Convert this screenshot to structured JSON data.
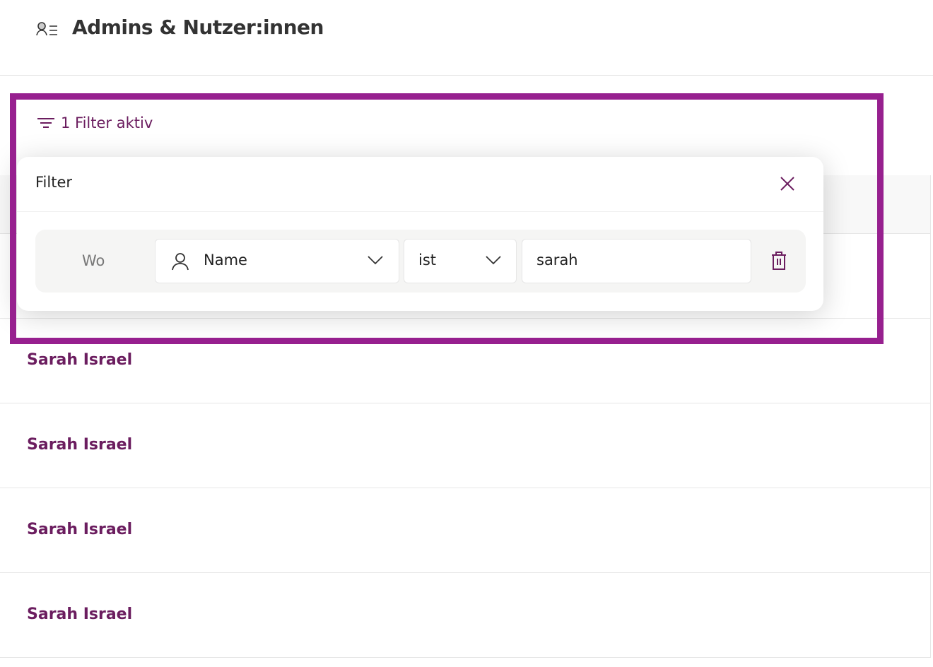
{
  "header": {
    "title": "Admins & Nutzer:innen",
    "icon": "user-list-icon"
  },
  "filter_toggle": {
    "label": "1 Filter aktiv",
    "icon": "filter-icon"
  },
  "filter_popup": {
    "title": "Filter",
    "rule": {
      "prefix": "Wo",
      "field": "Name",
      "operator": "ist",
      "value": "sarah"
    }
  },
  "rows": [
    {
      "name": "Sarah Israel"
    },
    {
      "name": "Sarah Israel"
    },
    {
      "name": "Sarah Israel"
    },
    {
      "name": "Sarah Israel"
    }
  ],
  "colors": {
    "accent": "#6b1d5f",
    "highlight": "#97208f"
  }
}
